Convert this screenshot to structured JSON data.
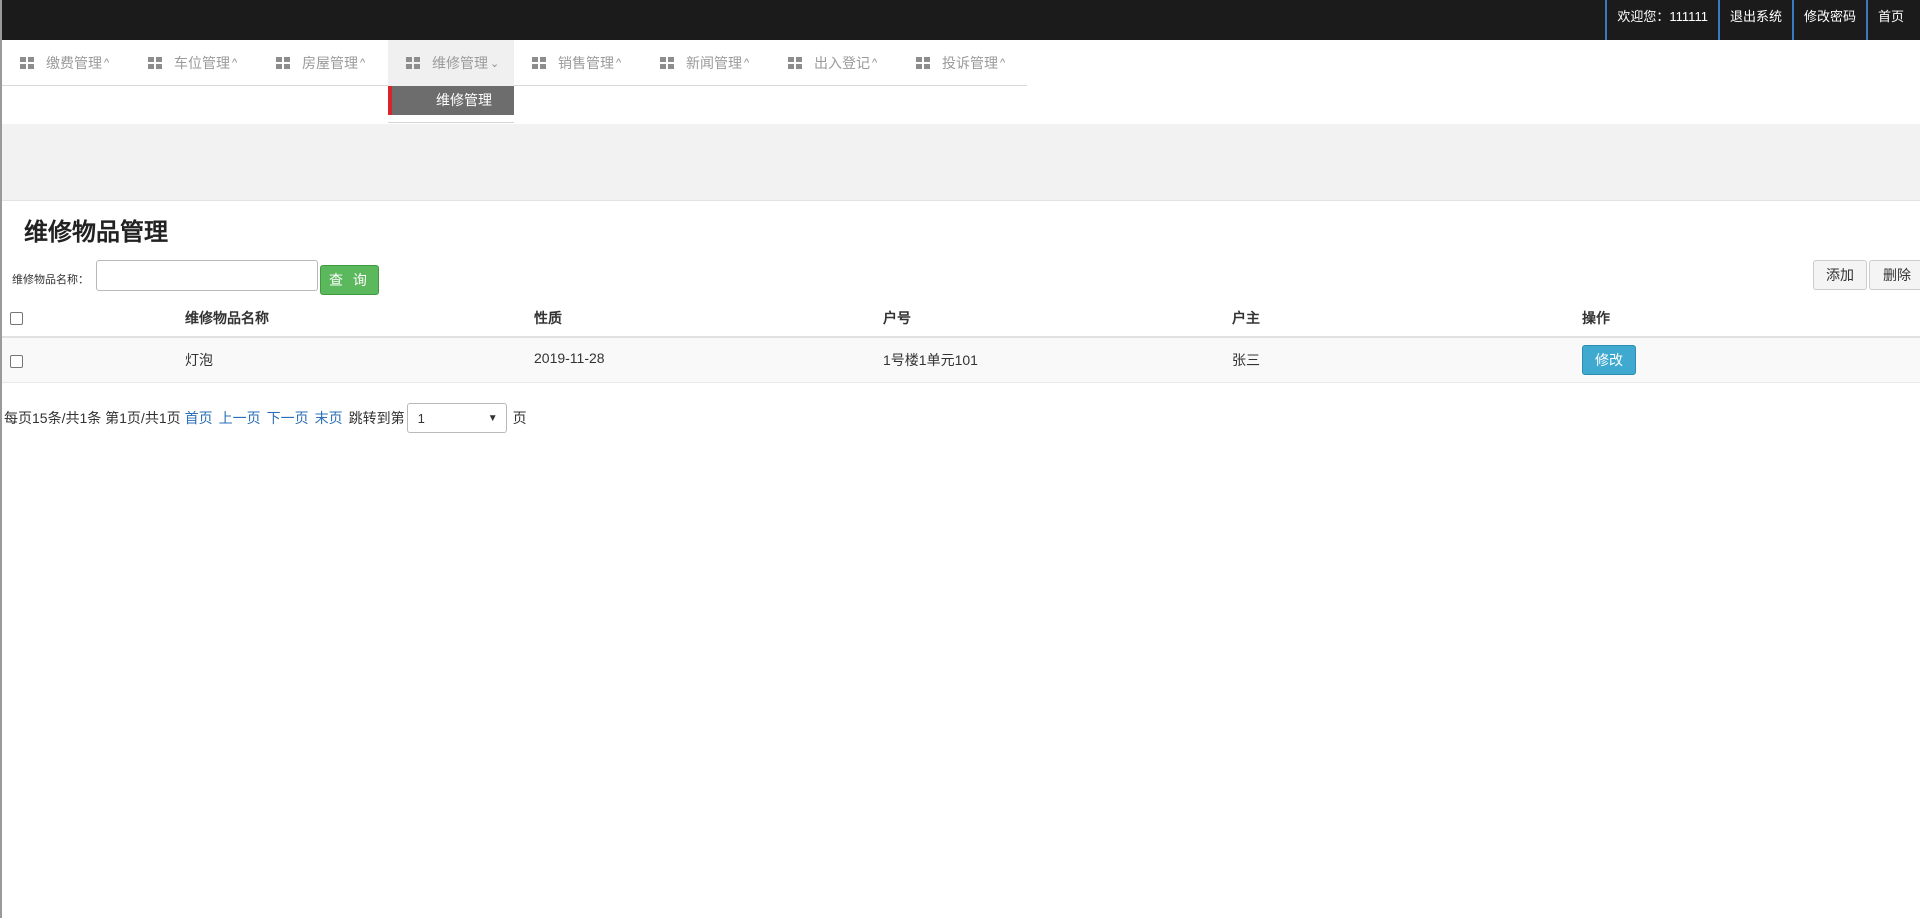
{
  "topbar": {
    "welcome": "欢迎您：111111",
    "logout": "退出系统",
    "change_password": "修改密码",
    "home": "首页"
  },
  "nav": {
    "items": [
      {
        "label": "缴费管理",
        "icon": "grid-icon",
        "caret": "^"
      },
      {
        "label": "车位管理",
        "icon": "grid-icon",
        "caret": "^"
      },
      {
        "label": "房屋管理",
        "icon": "grid-icon",
        "caret": "^"
      },
      {
        "label": "维修管理",
        "icon": "grid-icon",
        "caret": "⌄",
        "active": true
      },
      {
        "label": "销售管理",
        "icon": "grid-icon",
        "caret": "^"
      },
      {
        "label": "新闻管理",
        "icon": "grid-icon",
        "caret": "^"
      },
      {
        "label": "出入登记",
        "icon": "grid-icon",
        "caret": "^"
      },
      {
        "label": "投诉管理",
        "icon": "grid-icon",
        "caret": "^"
      }
    ],
    "submenu_item": "维修管理"
  },
  "page": {
    "title": "维修物品管理"
  },
  "search": {
    "label": "维修物品名称：",
    "value": "",
    "button": "查 询"
  },
  "actions": {
    "add": "添加",
    "delete": "删除"
  },
  "table": {
    "headers": [
      "维修物品名称",
      "性质",
      "户号",
      "户主",
      "操作"
    ],
    "rows": [
      {
        "name": "灯泡",
        "nature": "2019-11-28",
        "house_no": "1号楼1单元101",
        "owner": "张三",
        "action": "修改"
      }
    ]
  },
  "pager": {
    "summary": "每页15条/共1条 第1页/共1页",
    "first": "首页",
    "prev": "上一页",
    "next": "下一页",
    "last": "末页",
    "jump_label": "跳转到第",
    "page_value": "1",
    "page_suffix": "页"
  }
}
